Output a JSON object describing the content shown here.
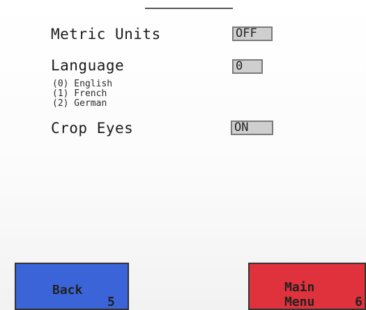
{
  "settings": {
    "metric_units": {
      "label": "Metric Units",
      "value": "OFF"
    },
    "language": {
      "label": "Language",
      "value": "0",
      "options": [
        "(0) English",
        "(1) French",
        "(2) German"
      ]
    },
    "crop_eyes": {
      "label": "Crop Eyes",
      "value": "ON"
    }
  },
  "buttons": {
    "back": {
      "label": "Back",
      "key": "5",
      "color": "#3a64d8"
    },
    "main_menu": {
      "label_line1": "Main",
      "label_line2": "Menu",
      "key": "6",
      "color": "#e0323c"
    }
  }
}
